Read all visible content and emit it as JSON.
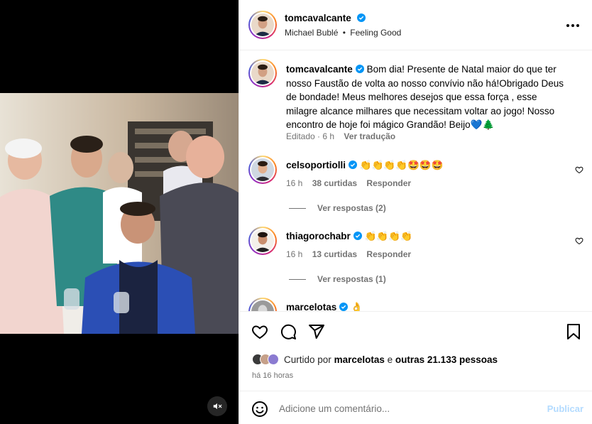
{
  "header": {
    "username": "tomcavalcante",
    "audio_artist": "Michael Bublé",
    "audio_separator": "•",
    "audio_track": "Feeling Good",
    "more_icon": "more-horizontal-icon"
  },
  "caption": {
    "username": "tomcavalcante",
    "text": "Bom dia! Presente de Natal maior do que ter nosso Faustão de volta ao nosso convívio não há!Obrigado Deus de bondade! Meus melhores desejos que essa força , esse milagre alcance milhares que necessitam voltar ao jogo! Nosso encontro de hoje foi mágico Grandão! Beijo💙🌲",
    "edited": "Editado",
    "age": "6 h",
    "translate": "Ver tradução"
  },
  "comments": [
    {
      "username": "celsoportiolli",
      "text": "👏👏👏👏🤩🤩🤩",
      "age": "16 h",
      "likes": "38 curtidas",
      "reply": "Responder",
      "view_replies": "Ver respostas (2)"
    },
    {
      "username": "thiagorochabr",
      "text": "👏👏👏👏",
      "age": "16 h",
      "likes": "13 curtidas",
      "reply": "Responder",
      "view_replies": "Ver respostas (1)"
    },
    {
      "username": "marcelotas",
      "text": "👌"
    }
  ],
  "actions": {
    "like_icon": "heart-icon",
    "comment_icon": "comment-icon",
    "share_icon": "send-icon",
    "save_icon": "bookmark-icon"
  },
  "likes": {
    "prefix": "Curtido por",
    "user": "marcelotas",
    "middle": "e",
    "others": "outras 21.133 pessoas"
  },
  "timestamp": "há 16 horas",
  "composer": {
    "placeholder": "Adicione um comentário...",
    "publish_label": "Publicar",
    "emoji_icon": "emoji-icon"
  },
  "colors": {
    "verified": "#0095f6",
    "secondary_text": "#737373",
    "publish_disabled": "#b3dbff",
    "border": "#efefef"
  }
}
